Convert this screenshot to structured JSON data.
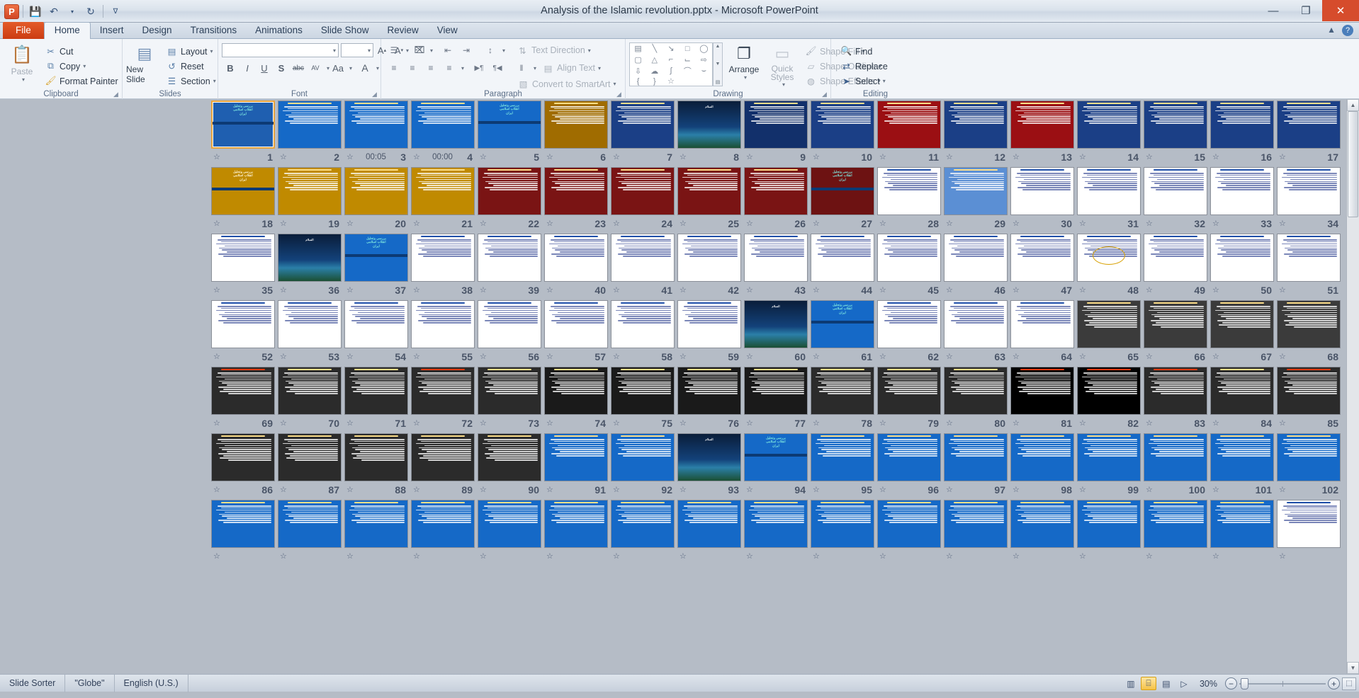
{
  "window": {
    "title": "Analysis of the Islamic revolution.pptx  -  Microsoft PowerPoint",
    "minimize": "—",
    "restore": "❐",
    "close": "✕"
  },
  "qat": {
    "logo": "P",
    "save": "💾",
    "undo": "↶",
    "undo_caret": "▾",
    "redo": "↻",
    "customize": "∇"
  },
  "tabs": [
    {
      "label": "File",
      "kind": "file"
    },
    {
      "label": "Home",
      "kind": "active"
    },
    {
      "label": "Insert",
      "kind": "normal"
    },
    {
      "label": "Design",
      "kind": "normal"
    },
    {
      "label": "Transitions",
      "kind": "normal"
    },
    {
      "label": "Animations",
      "kind": "normal"
    },
    {
      "label": "Slide Show",
      "kind": "normal"
    },
    {
      "label": "Review",
      "kind": "normal"
    },
    {
      "label": "View",
      "kind": "normal"
    }
  ],
  "tab_right": {
    "minimize_ribbon": "▲",
    "help": "?"
  },
  "ribbon": {
    "clipboard": {
      "label": "Clipboard",
      "paste": "Paste",
      "paste_icon": "📋",
      "items": [
        {
          "label": "Cut",
          "icon": "✂"
        },
        {
          "label": "Copy",
          "icon": "⧉",
          "caret": "▾"
        },
        {
          "label": "Format Painter",
          "icon": "🖌"
        }
      ],
      "dialog_launcher": "◢"
    },
    "slides": {
      "label": "Slides",
      "new_slide": "New Slide",
      "new_slide_caret": "▾",
      "items": [
        {
          "label": "Layout",
          "icon": "▤",
          "caret": "▾"
        },
        {
          "label": "Reset",
          "icon": "↺"
        },
        {
          "label": "Section",
          "icon": "☰",
          "caret": "▾"
        }
      ]
    },
    "font": {
      "label": "Font",
      "font_name": "",
      "font_name_caret": "▾",
      "font_size": "",
      "font_size_caret": "▾",
      "grow": "A↑",
      "shrink": "A↓",
      "clear_formatting": "⌧",
      "bold": "B",
      "italic": "I",
      "underline": "U",
      "shadow": "S",
      "strikethrough": "abc",
      "spacing": "AV",
      "change_case": "Aa",
      "font_color": "A",
      "dialog_launcher": "◢"
    },
    "paragraph": {
      "label": "Paragraph",
      "bullets": "☰",
      "numbering": "☷",
      "decrease_indent": "⇤",
      "increase_indent": "⇥",
      "line_spacing": "↕",
      "align_left": "≡",
      "align_center": "≡",
      "align_right": "≡",
      "justify": "≡",
      "ltr": "▶¶",
      "rtl": "¶◀",
      "columns": "‖",
      "text_direction": "Text Direction",
      "align_text": "Align Text",
      "convert_to_smartart": "Convert to SmartArt",
      "dialog_launcher": "◢"
    },
    "drawing": {
      "label": "Drawing",
      "shapes": [
        "▤",
        "╲",
        "↘",
        "□",
        "◯",
        "▢",
        "△",
        "⌐",
        "⌙",
        "⇨",
        "⇩",
        "☁",
        "∫",
        "⌒",
        "⌣",
        "{",
        "}",
        "☆"
      ],
      "arrange": "Arrange",
      "arrange_caret": "▾",
      "quick_styles": "Quick Styles",
      "quick_styles_caret": "▾",
      "shape_fill": "Shape Fill",
      "shape_outline": "Shape Outline",
      "shape_effects": "Shape Effects",
      "dialog_launcher": "◢"
    },
    "editing": {
      "label": "Editing",
      "find": "Find",
      "find_icon": "🔍",
      "replace": "Replace",
      "replace_icon": "⇄",
      "select": "Select",
      "select_icon": "➤",
      "select_caret": "▾"
    }
  },
  "slide_sorter": {
    "transition_icon": "☆",
    "rows": [
      [
        {
          "n": "17",
          "bg": "#1b3f86",
          "kind": "text"
        },
        {
          "n": "16",
          "bg": "#1b3f86",
          "kind": "text"
        },
        {
          "n": "15",
          "bg": "#1b3f86",
          "kind": "text"
        },
        {
          "n": "14",
          "bg": "#1b3f86",
          "kind": "title-bullets"
        },
        {
          "n": "13",
          "bg": "#9b0f13",
          "kind": "text"
        },
        {
          "n": "12",
          "bg": "#1b3f86",
          "kind": "text"
        },
        {
          "n": "11",
          "bg": "#9b0f13",
          "kind": "title-bullets"
        },
        {
          "n": "10",
          "bg": "#1b3f86",
          "kind": "text"
        },
        {
          "n": "9",
          "bg": "#12306b",
          "kind": "text"
        },
        {
          "n": "8",
          "bg": "#0a2a4e",
          "kind": "photo-dark"
        },
        {
          "n": "7",
          "bg": "#1b3f86",
          "kind": "text"
        },
        {
          "n": "6",
          "bg": "#a06c00",
          "kind": "title-bullets"
        },
        {
          "n": "5",
          "bg": "#1569c7",
          "kind": "title-center"
        },
        {
          "n": "4",
          "bg": "#1569c7",
          "kind": "text",
          "time": "00:00"
        },
        {
          "n": "3",
          "bg": "#1569c7",
          "kind": "text",
          "time": "00:05"
        },
        {
          "n": "2",
          "bg": "#1569c7",
          "kind": "text"
        },
        {
          "n": "1",
          "bg": "#1f5fb0",
          "kind": "title-center",
          "selected": true
        }
      ],
      [
        {
          "n": "34",
          "bg": "#ffffff",
          "kind": "light"
        },
        {
          "n": "33",
          "bg": "#ffffff",
          "kind": "light"
        },
        {
          "n": "32",
          "bg": "#ffffff",
          "kind": "light"
        },
        {
          "n": "31",
          "bg": "#ffffff",
          "kind": "light"
        },
        {
          "n": "30",
          "bg": "#ffffff",
          "kind": "light"
        },
        {
          "n": "29",
          "bg": "#5b8fd4",
          "kind": "text"
        },
        {
          "n": "28",
          "bg": "#ffffff",
          "kind": "light"
        },
        {
          "n": "27",
          "bg": "#6d1212",
          "kind": "title-center"
        },
        {
          "n": "26",
          "bg": "#7a1414",
          "kind": "title-bullets"
        },
        {
          "n": "25",
          "bg": "#7a1414",
          "kind": "title-bullets"
        },
        {
          "n": "24",
          "bg": "#7a1414",
          "kind": "title-bullets"
        },
        {
          "n": "23",
          "bg": "#7a1414",
          "kind": "title-bullets"
        },
        {
          "n": "22",
          "bg": "#7a1414",
          "kind": "title-bullets"
        },
        {
          "n": "21",
          "bg": "#c08a00",
          "kind": "title-bullets"
        },
        {
          "n": "20",
          "bg": "#c08a00",
          "kind": "title-bullets"
        },
        {
          "n": "19",
          "bg": "#c08a00",
          "kind": "title-bullets"
        },
        {
          "n": "18",
          "bg": "#c08a00",
          "kind": "title-center"
        }
      ],
      [
        {
          "n": "51",
          "bg": "#ffffff",
          "kind": "light"
        },
        {
          "n": "50",
          "bg": "#ffffff",
          "kind": "light"
        },
        {
          "n": "49",
          "bg": "#ffffff",
          "kind": "light"
        },
        {
          "n": "48",
          "bg": "#ffffff",
          "kind": "light-oval"
        },
        {
          "n": "47",
          "bg": "#ffffff",
          "kind": "light"
        },
        {
          "n": "46",
          "bg": "#ffffff",
          "kind": "light"
        },
        {
          "n": "45",
          "bg": "#ffffff",
          "kind": "light"
        },
        {
          "n": "44",
          "bg": "#ffffff",
          "kind": "light"
        },
        {
          "n": "43",
          "bg": "#ffffff",
          "kind": "light"
        },
        {
          "n": "42",
          "bg": "#ffffff",
          "kind": "light"
        },
        {
          "n": "41",
          "bg": "#ffffff",
          "kind": "light"
        },
        {
          "n": "40",
          "bg": "#ffffff",
          "kind": "light"
        },
        {
          "n": "39",
          "bg": "#ffffff",
          "kind": "light"
        },
        {
          "n": "38",
          "bg": "#ffffff",
          "kind": "light"
        },
        {
          "n": "37",
          "bg": "#1569c7",
          "kind": "title-center"
        },
        {
          "n": "36",
          "bg": "#0e2a52",
          "kind": "photo-dark"
        },
        {
          "n": "35",
          "bg": "#ffffff",
          "kind": "light"
        }
      ],
      [
        {
          "n": "68",
          "bg": "#3b3b3b",
          "kind": "dark"
        },
        {
          "n": "67",
          "bg": "#3b3b3b",
          "kind": "dark"
        },
        {
          "n": "66",
          "bg": "#3b3b3b",
          "kind": "dark"
        },
        {
          "n": "65",
          "bg": "#3b3b3b",
          "kind": "dark"
        },
        {
          "n": "64",
          "bg": "#ffffff",
          "kind": "light"
        },
        {
          "n": "63",
          "bg": "#ffffff",
          "kind": "light"
        },
        {
          "n": "62",
          "bg": "#ffffff",
          "kind": "light"
        },
        {
          "n": "61",
          "bg": "#1569c7",
          "kind": "title-center"
        },
        {
          "n": "60",
          "bg": "#0d2a55",
          "kind": "photo-dark"
        },
        {
          "n": "59",
          "bg": "#ffffff",
          "kind": "light"
        },
        {
          "n": "58",
          "bg": "#ffffff",
          "kind": "light"
        },
        {
          "n": "57",
          "bg": "#ffffff",
          "kind": "light"
        },
        {
          "n": "56",
          "bg": "#ffffff",
          "kind": "light"
        },
        {
          "n": "55",
          "bg": "#ffffff",
          "kind": "light"
        },
        {
          "n": "54",
          "bg": "#ffffff",
          "kind": "light"
        },
        {
          "n": "53",
          "bg": "#ffffff",
          "kind": "light"
        },
        {
          "n": "52",
          "bg": "#ffffff",
          "kind": "light"
        }
      ],
      [
        {
          "n": "85",
          "bg": "#2b2b2b",
          "kind": "dark-red"
        },
        {
          "n": "84",
          "bg": "#2b2b2b",
          "kind": "dark"
        },
        {
          "n": "83",
          "bg": "#2b2b2b",
          "kind": "dark-red"
        },
        {
          "n": "82",
          "bg": "#000000",
          "kind": "dark-red"
        },
        {
          "n": "81",
          "bg": "#000000",
          "kind": "dark-red"
        },
        {
          "n": "80",
          "bg": "#2b2b2b",
          "kind": "dark"
        },
        {
          "n": "79",
          "bg": "#2b2b2b",
          "kind": "dark"
        },
        {
          "n": "78",
          "bg": "#2b2b2b",
          "kind": "dark"
        },
        {
          "n": "77",
          "bg": "#1a1a1a",
          "kind": "dark"
        },
        {
          "n": "76",
          "bg": "#1a1a1a",
          "kind": "dark"
        },
        {
          "n": "75",
          "bg": "#1a1a1a",
          "kind": "dark"
        },
        {
          "n": "74",
          "bg": "#1a1a1a",
          "kind": "dark"
        },
        {
          "n": "73",
          "bg": "#2b2b2b",
          "kind": "dark"
        },
        {
          "n": "72",
          "bg": "#2b2b2b",
          "kind": "dark-red"
        },
        {
          "n": "71",
          "bg": "#2b2b2b",
          "kind": "dark"
        },
        {
          "n": "70",
          "bg": "#2b2b2b",
          "kind": "dark"
        },
        {
          "n": "69",
          "bg": "#2b2b2b",
          "kind": "dark-red"
        }
      ],
      [
        {
          "n": "102",
          "bg": "#1569c7",
          "kind": "text"
        },
        {
          "n": "101",
          "bg": "#1569c7",
          "kind": "text"
        },
        {
          "n": "100",
          "bg": "#1569c7",
          "kind": "text"
        },
        {
          "n": "99",
          "bg": "#1569c7",
          "kind": "text"
        },
        {
          "n": "98",
          "bg": "#1569c7",
          "kind": "text"
        },
        {
          "n": "97",
          "bg": "#1569c7",
          "kind": "text"
        },
        {
          "n": "96",
          "bg": "#1569c7",
          "kind": "text"
        },
        {
          "n": "95",
          "bg": "#1569c7",
          "kind": "text"
        },
        {
          "n": "94",
          "bg": "#1569c7",
          "kind": "title-center"
        },
        {
          "n": "93",
          "bg": "#0a2a4e",
          "kind": "photo-dark"
        },
        {
          "n": "92",
          "bg": "#1569c7",
          "kind": "text"
        },
        {
          "n": "91",
          "bg": "#1569c7",
          "kind": "text"
        },
        {
          "n": "90",
          "bg": "#2b2b2b",
          "kind": "dark"
        },
        {
          "n": "89",
          "bg": "#2b2b2b",
          "kind": "dark"
        },
        {
          "n": "88",
          "bg": "#2b2b2b",
          "kind": "dark"
        },
        {
          "n": "87",
          "bg": "#2b2b2b",
          "kind": "dark"
        },
        {
          "n": "86",
          "bg": "#2b2b2b",
          "kind": "dark"
        }
      ],
      [
        {
          "n": "",
          "bg": "#ffffff",
          "kind": "light"
        },
        {
          "n": "",
          "bg": "#1569c7",
          "kind": "text"
        },
        {
          "n": "",
          "bg": "#1569c7",
          "kind": "text"
        },
        {
          "n": "",
          "bg": "#1569c7",
          "kind": "text"
        },
        {
          "n": "",
          "bg": "#1569c7",
          "kind": "text"
        },
        {
          "n": "",
          "bg": "#1569c7",
          "kind": "text"
        },
        {
          "n": "",
          "bg": "#1569c7",
          "kind": "text"
        },
        {
          "n": "",
          "bg": "#1569c7",
          "kind": "text"
        },
        {
          "n": "",
          "bg": "#1569c7",
          "kind": "text"
        },
        {
          "n": "",
          "bg": "#1569c7",
          "kind": "text"
        },
        {
          "n": "",
          "bg": "#1569c7",
          "kind": "text"
        },
        {
          "n": "",
          "bg": "#1569c7",
          "kind": "text"
        },
        {
          "n": "",
          "bg": "#1569c7",
          "kind": "text"
        },
        {
          "n": "",
          "bg": "#1569c7",
          "kind": "text"
        },
        {
          "n": "",
          "bg": "#1569c7",
          "kind": "text"
        },
        {
          "n": "",
          "bg": "#1569c7",
          "kind": "text"
        },
        {
          "n": "",
          "bg": "#1569c7",
          "kind": "text"
        }
      ]
    ],
    "scrollbar": {
      "up": "▲",
      "down": "▼"
    }
  },
  "status": {
    "view_mode": "Slide Sorter",
    "theme": "\"Globe\"",
    "language": "English (U.S.)",
    "views": [
      {
        "name": "normal-view",
        "glyph": "▥",
        "active": false
      },
      {
        "name": "slide-sorter-view",
        "glyph": "⌸",
        "active": true
      },
      {
        "name": "reading-view",
        "glyph": "▤",
        "active": false
      },
      {
        "name": "slide-show-view",
        "glyph": "▷",
        "active": false
      }
    ],
    "zoom": "30%",
    "zoom_out": "−",
    "zoom_in": "+",
    "fit_to_window": "⬚"
  }
}
